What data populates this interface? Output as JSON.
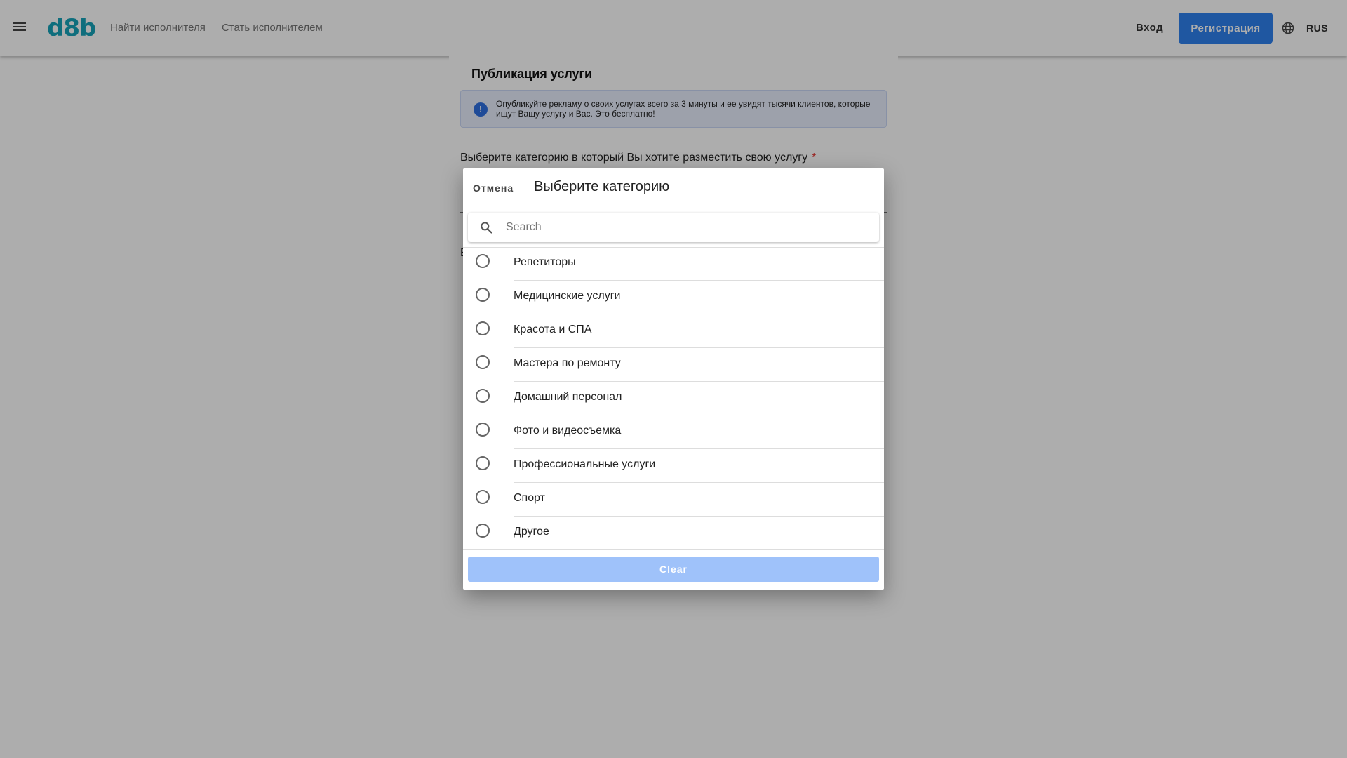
{
  "header": {
    "logo": "d8b",
    "nav": {
      "find": "Найти исполнителя",
      "become": "Стать исполнителем"
    },
    "login": "Вход",
    "register": "Регистрация",
    "language": "RUS"
  },
  "page": {
    "title": "Публикация услуги",
    "info": "Опубликуйте рекламу о своих услугах всего за 3 минуты и ее увидят тысячи клиентов, которые ищут Вашу услугу и Вас. Это бесплатно!",
    "category_label": "Выберите категорию в который Вы хотите разместить свою услугу",
    "required_mark": "*",
    "second_label": "В"
  },
  "dialog": {
    "cancel": "Отмена",
    "title": "Выберите категорию",
    "search_placeholder": "Search",
    "search_value": "",
    "items": [
      {
        "label": "Репетиторы"
      },
      {
        "label": "Медицинские услуги"
      },
      {
        "label": "Красота и СПА"
      },
      {
        "label": "Мастера по ремонту"
      },
      {
        "label": "Домашний персонал"
      },
      {
        "label": "Фото и видеосъемка"
      },
      {
        "label": "Профессиональные услуги"
      },
      {
        "label": "Спорт"
      },
      {
        "label": "Другое"
      }
    ],
    "clear": "Clear"
  },
  "colors": {
    "brand": "#17a2b8",
    "primary": "#2f80ed",
    "clear_button": "#9fc2fa",
    "required": "#e53935"
  },
  "icons": {
    "menu": "menu-icon",
    "globe": "globe-icon",
    "info": "info-icon",
    "search": "search-icon"
  }
}
